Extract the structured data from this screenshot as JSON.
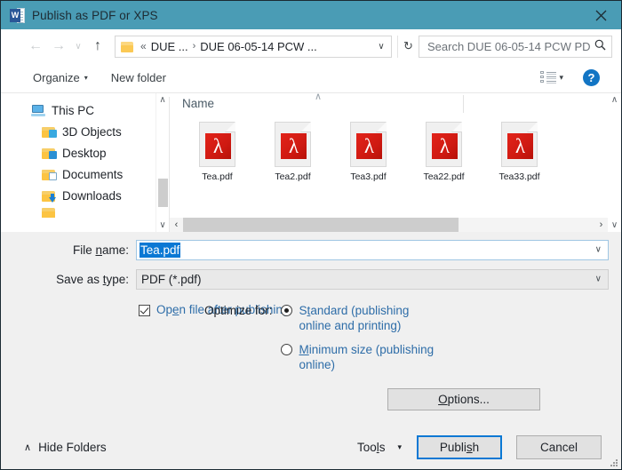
{
  "window": {
    "title": "Publish as PDF or XPS",
    "app_icon": "word-icon",
    "close_label": "✕",
    "titlebar_color": "#4a9cb5"
  },
  "nav": {
    "back_icon": "←",
    "forward_icon": "→",
    "history_icon": "∨",
    "up_icon": "↑",
    "folder_icon": "folder-icon",
    "breadcrumb_prefix": "«",
    "breadcrumbs": [
      "DUE ...",
      "DUE 06-05-14 PCW ..."
    ],
    "separator": "›",
    "address_dropdown_icon": "∨",
    "refresh_icon": "↻",
    "search_placeholder": "Search DUE 06-05-14 PCW PD...",
    "search_value": "",
    "search_icon": "⚲"
  },
  "toolbar": {
    "organize_label": "Organize",
    "organize_caret": "▾",
    "new_folder_label": "New folder",
    "view_icon": "list-view-icon",
    "view_caret": "▾",
    "help_label": "?"
  },
  "sidebar": {
    "items": [
      {
        "label": "This PC",
        "icon": "pc-icon",
        "level": 0
      },
      {
        "label": "3D Objects",
        "icon": "folder-3d-icon",
        "level": 1
      },
      {
        "label": "Desktop",
        "icon": "folder-desktop-icon",
        "level": 1
      },
      {
        "label": "Documents",
        "icon": "folder-documents-icon",
        "level": 1
      },
      {
        "label": "Downloads",
        "icon": "folder-downloads-icon",
        "level": 1
      },
      {
        "label": "",
        "icon": "folder-icon",
        "level": 1
      }
    ],
    "scroll_up_icon": "∧",
    "scroll_down_icon": "∨"
  },
  "file_pane": {
    "column_header": "Name",
    "sort_indicator": "∧",
    "files": [
      {
        "name": "Tea.pdf",
        "type": "pdf"
      },
      {
        "name": "Tea2.pdf",
        "type": "pdf"
      },
      {
        "name": "Tea3.pdf",
        "type": "pdf"
      },
      {
        "name": "Tea22.pdf",
        "type": "pdf"
      },
      {
        "name": "Tea33.pdf",
        "type": "pdf"
      }
    ],
    "pdf_glyph": "λ",
    "hscroll_left_icon": "‹",
    "hscroll_right_icon": "›",
    "vscroll_up_icon": "∧",
    "vscroll_down_icon": "∨"
  },
  "form": {
    "file_name_label": "File name:",
    "file_name_value": "Tea.pdf",
    "file_name_selected": true,
    "save_as_type_label": "Save as type:",
    "save_as_type_value": "PDF (*.pdf)",
    "dropdown_caret": "∨",
    "open_after_publishing_label": "Open file after publishing",
    "open_after_publishing_checked": true,
    "optimize_label": "Optimize for:",
    "radios": [
      {
        "line1": "Standard (publishing",
        "line2": "online and printing)",
        "selected": true
      },
      {
        "line1": "Minimum size",
        "line2": "(publishing online)",
        "selected": false
      }
    ],
    "options_button": "Options...",
    "accent_color": "#2e6da8",
    "selection_color": "#0a78d4"
  },
  "footer": {
    "hide_folders_caret": "∧",
    "hide_folders_label": "Hide Folders",
    "tools_label": "Tools",
    "tools_caret": "▾",
    "publish_label": "Publish",
    "cancel_label": "Cancel"
  }
}
